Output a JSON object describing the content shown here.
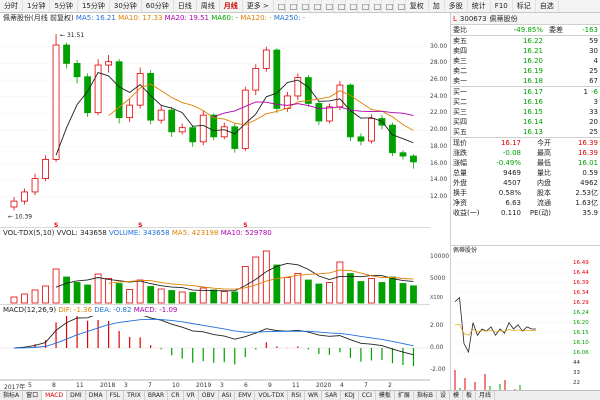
{
  "toolbar": {
    "items": [
      "分时",
      "1分钟",
      "5分钟",
      "15分钟",
      "30分钟",
      "60分钟",
      "日线",
      "周线",
      "月线",
      "更多 >",
      "",
      "",
      "",
      "",
      "",
      "",
      "",
      "",
      "",
      "",
      "",
      "复权",
      "加",
      "多股",
      "统计",
      "F10",
      "标记",
      "自选"
    ],
    "active": "月线"
  },
  "info": {
    "stock_label": "佩蒂股份(月线 前复权)",
    "ma5": "MA5: 16.21",
    "ma10": "MA10: 17.33",
    "ma20": "MA20: 19.51",
    "ma60": "MA60: -",
    "ma120": "MA120: -",
    "ma250": "MA250: -"
  },
  "main_chart": {
    "y_ticks": [
      "30.00",
      "28.00",
      "26.00",
      "24.00",
      "22.00",
      "20.00",
      "18.00",
      "16.00",
      "14.00",
      "12.00"
    ],
    "high_label": "31.51",
    "low_label": "10.39",
    "markers": [
      "S",
      "S",
      "S"
    ]
  },
  "vol_panel": {
    "label": "VOL-TDX(5,10)",
    "vvol": "VVOL: 343658",
    "volume": "VOLUME: 343658",
    "ma5": "MA5: 423198",
    "ma10": "MA10: 529780",
    "y_ticks": [
      "10000",
      "5000"
    ],
    "unit": "X100"
  },
  "macd_panel": {
    "label": "MACD(12,26,9)",
    "dif": "DIF: -1.36",
    "dea": "DEA: -0.82",
    "macd": "MACD: -1.09",
    "y_ticks": [
      "2.00",
      "0.00",
      "-2.00"
    ]
  },
  "dates": [
    "2017年",
    "5",
    "8",
    "11",
    "2018",
    "3",
    "7",
    "10",
    "2019",
    "3",
    "6",
    "9",
    "11",
    "2020",
    "4",
    "7",
    "2"
  ],
  "bottom_tabs": [
    "指标A",
    "窗口",
    "MACD",
    "DMI",
    "DMA",
    "FSL",
    "TRIX",
    "BRAR",
    "CR",
    "VR",
    "OBV",
    "ASI",
    "EMV",
    "VOL-TDX",
    "RSI",
    "WR",
    "SAR",
    "KDJ",
    "CCI",
    "模板",
    "扩展",
    "指标B",
    "设",
    "模",
    "板",
    "月线"
  ],
  "bottom_active": "MACD",
  "quote": {
    "code": "300673",
    "name": "佩蒂股份",
    "webi_label": "委比",
    "webi": "-49.85%",
    "weicha_label": "委差",
    "weicha": "-163",
    "asks": [
      {
        "label": "卖五",
        "price": "16.22",
        "vol": "59"
      },
      {
        "label": "卖四",
        "price": "16.21",
        "vol": "30"
      },
      {
        "label": "卖三",
        "price": "16.20",
        "vol": "4"
      },
      {
        "label": "卖二",
        "price": "16.19",
        "vol": "25"
      },
      {
        "label": "卖一",
        "price": "16.18",
        "vol": "67"
      }
    ],
    "bids": [
      {
        "label": "买一",
        "price": "16.17",
        "vol": "1",
        "extra": "-6"
      },
      {
        "label": "买二",
        "price": "16.16",
        "vol": "3"
      },
      {
        "label": "买三",
        "price": "16.15",
        "vol": "33"
      },
      {
        "label": "买四",
        "price": "16.14",
        "vol": "20"
      },
      {
        "label": "买五",
        "price": "16.13",
        "vol": "25"
      }
    ],
    "stats": [
      {
        "l1": "现价",
        "v1": "16.17",
        "l2": "今开",
        "v2": "16.39"
      },
      {
        "l1": "涨跌",
        "v1": "-0.08",
        "l2": "最高",
        "v2": "16.39"
      },
      {
        "l1": "涨幅",
        "v1": "-0.49%",
        "l2": "最低",
        "v2": "16.01"
      },
      {
        "l1": "总量",
        "v1": "9469",
        "l2": "量比",
        "v2": "0.59"
      },
      {
        "l1": "外盘",
        "v1": "4507",
        "l2": "内盘",
        "v2": "4962"
      },
      {
        "l1": "换手",
        "v1": "0.58%",
        "l2": "股本",
        "v2": "2.53亿"
      },
      {
        "l1": "净资",
        "v1": "6.63",
        "l2": "流通",
        "v2": "1.63亿"
      },
      {
        "l1": "收益(一)",
        "v1": "0.110",
        "l2": "PE(动)",
        "v2": "35.9"
      }
    ]
  },
  "mini": {
    "label": "佩蒂股份",
    "y_ticks": [
      "16.49",
      "16.44",
      "16.39",
      "16.34",
      "16.29",
      "16.24",
      "16.20",
      "16.15",
      "16.10",
      "16.06"
    ],
    "vol_ticks": [
      "44",
      "33",
      "22",
      "11"
    ]
  },
  "colors": {
    "up": "#e00000",
    "down": "#00a000",
    "ma5": "#222222",
    "ma10": "#e08000",
    "ma20": "#b000b0",
    "ma60": "#1e6fd9"
  },
  "chart_data": {
    "type": "candlestick",
    "closes": [
      11.5,
      12.6,
      14.2,
      16.5,
      30.2,
      28.0,
      26.4,
      22.1,
      27.8,
      28.2,
      21.5,
      23.0,
      26.8,
      21.2,
      22.4,
      19.8,
      20.3,
      18.6,
      21.8,
      19.2,
      20.4,
      17.8,
      24.8,
      27.4,
      29.6,
      22.6,
      24.1,
      26.3,
      23.2,
      21.1,
      22.8,
      25.4,
      19.2,
      18.7,
      21.4,
      20.6,
      17.3,
      16.9,
      16.2
    ],
    "opens": [
      10.8,
      11.5,
      12.6,
      14.2,
      16.5,
      30.2,
      28.0,
      26.4,
      22.1,
      27.8,
      28.2,
      21.5,
      23.0,
      26.8,
      21.2,
      22.4,
      19.8,
      20.3,
      18.6,
      21.8,
      19.2,
      20.4,
      17.8,
      24.8,
      27.4,
      29.6,
      22.6,
      24.1,
      26.3,
      23.2,
      21.1,
      22.8,
      25.4,
      19.2,
      18.7,
      21.4,
      20.6,
      17.3,
      16.9
    ],
    "highs": [
      12.0,
      13.0,
      14.8,
      17.0,
      31.51,
      30.5,
      28.4,
      26.8,
      28.5,
      29.0,
      28.5,
      23.8,
      27.5,
      27.2,
      23.0,
      22.8,
      20.8,
      20.6,
      22.3,
      22.0,
      20.9,
      20.8,
      25.2,
      27.9,
      30.0,
      29.8,
      24.6,
      26.8,
      26.6,
      23.5,
      23.2,
      25.9,
      25.6,
      19.6,
      21.9,
      21.8,
      20.9,
      17.6,
      17.1
    ],
    "lows": [
      10.39,
      11.1,
      12.2,
      13.9,
      16.2,
      27.4,
      25.6,
      21.6,
      21.8,
      26.9,
      20.8,
      21.0,
      22.6,
      20.7,
      20.8,
      19.2,
      19.5,
      18.0,
      18.2,
      18.8,
      18.9,
      17.3,
      17.5,
      24.2,
      27.0,
      22.1,
      22.2,
      23.6,
      22.8,
      20.6,
      20.8,
      22.4,
      18.7,
      18.2,
      18.4,
      20.1,
      16.9,
      16.5,
      15.4
    ],
    "volumes": [
      1200,
      1800,
      2600,
      3400,
      6800,
      5200,
      4100,
      3600,
      5800,
      4900,
      3900,
      2700,
      4600,
      3300,
      2800,
      2500,
      2200,
      2100,
      3000,
      2600,
      2300,
      2200,
      7300,
      9200,
      10400,
      7600,
      5100,
      5900,
      4600,
      3800,
      4100,
      8200,
      5900,
      4300,
      4900,
      4100,
      5200,
      3900,
      3437
    ]
  }
}
